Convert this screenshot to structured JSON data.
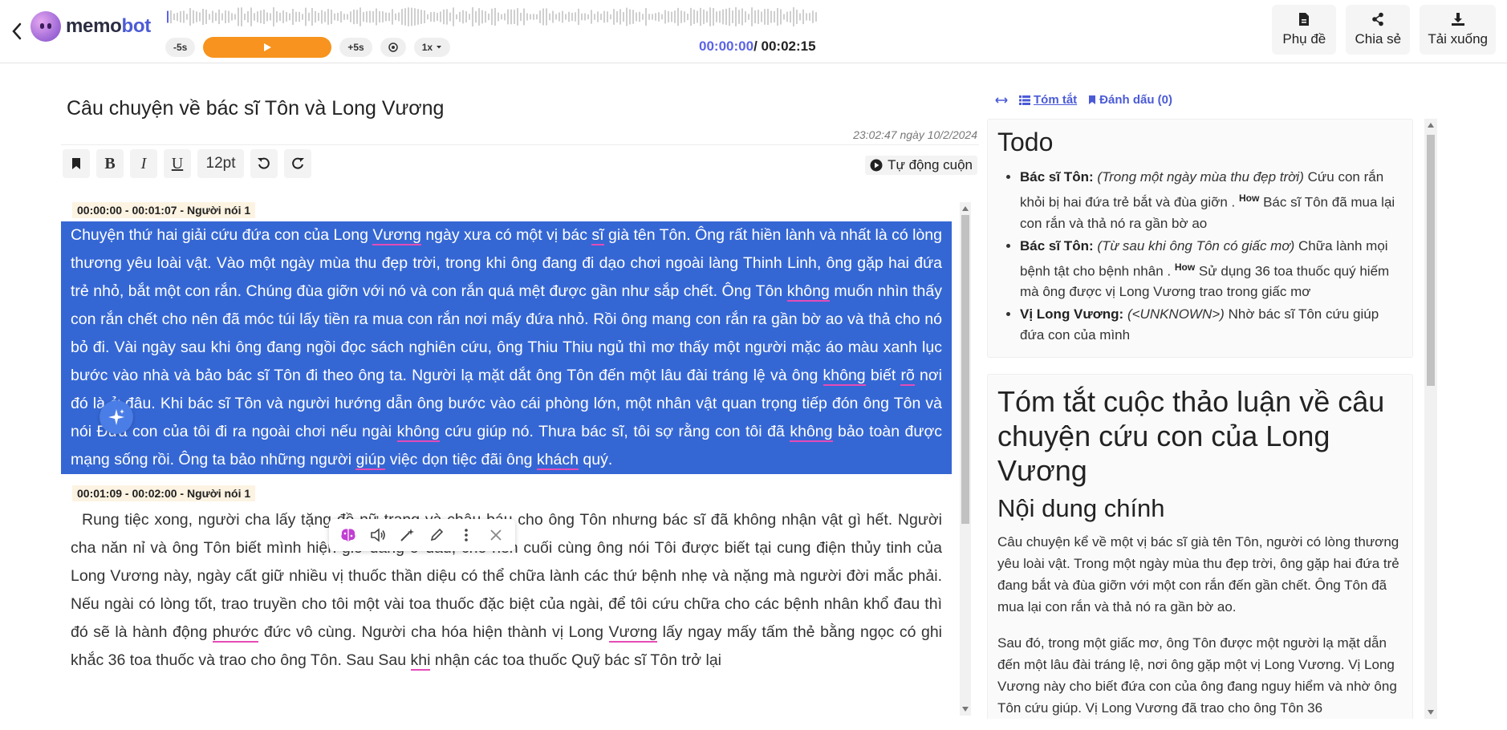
{
  "app": {
    "logo_prefix": "memo",
    "logo_suffix": "bot"
  },
  "player": {
    "skip_back": "-5s",
    "skip_forward": "+5s",
    "speed": "1x",
    "current_time": "00:00:00",
    "total_time": "/ 00:02:15"
  },
  "top_actions": [
    {
      "label": "Phụ đề",
      "icon": "file-icon"
    },
    {
      "label": "Chia sẻ",
      "icon": "share-icon"
    },
    {
      "label": "Tải xuống",
      "icon": "download-icon"
    }
  ],
  "document": {
    "title": "Câu chuyện về bác sĩ Tôn và Long Vương",
    "date": "23:02:47 ngày 10/2/2024"
  },
  "toolbar": {
    "bold": "B",
    "italic": "I",
    "underline": "U",
    "font_size": "12pt",
    "autoscroll": "Tự động cuộn"
  },
  "segments": [
    {
      "header": "00:00:00 - 00:01:07 - Người nói 1",
      "parts": [
        " Chuyện thứ hai giải cứu đứa con của Long ",
        {
          "u": "Vương"
        },
        " ngày xưa có một vị bác ",
        {
          "u": "sĩ"
        },
        " già tên Tôn. Ông rất hiền lành và nhất là có lòng thương yêu loài vật. Vào một ngày mùa thu đẹp trời, trong khi ông đang đi dạo chơi ngoài làng Thinh Linh, ông gặp hai đứa trẻ nhỏ, bắt một con rắn. Chúng đùa giỡn với nó và con rắn quá mệt được gần như sắp chết. Ông Tôn ",
        {
          "u": "không"
        },
        " muốn nhìn thấy con rắn chết cho nên đã móc túi lấy tiền ra mua con rắn nơi mấy đứa nhỏ. Rồi ông mang con rắn ra gần bờ ao và thả cho nó bỏ đi. Vài ngày sau khi ông đang ngồi đọc sách nghiên cứu, ông Thiu Thiu ngủ thì mơ thấy một người mặc áo màu xanh lục bước vào nhà và bảo bác sĩ Tôn đi theo ông ta. Người lạ mặt dắt ông Tôn đến một lâu đài tráng lệ và ông ",
        {
          "u": "không"
        },
        " biết ",
        {
          "u": "rõ"
        },
        " nơi đó là ở đâu. Khi bác sĩ Tôn và người hướng dẫn ông bước vào cái phòng lớn, một nhân vật quan trọng tiếp đón ông Tôn và nói Đứa con của tôi đi ra ngoài chơi nếu ngài ",
        {
          "u": "không"
        },
        " cứu giúp nó. Thưa bác sĩ, tôi sợ rằng con tôi đã ",
        {
          "u": "không"
        },
        " bảo toàn được mạng sống rồi. Ông ta bảo những người ",
        {
          "u": "giúp"
        },
        " việc dọn tiệc đãi ông ",
        {
          "u": "khách"
        },
        " quý."
      ]
    },
    {
      "header": "00:01:09 - 00:02:00 - Người nói 1",
      "parts": [
        "Rung tiệc xong, người cha lấy tặng đồ nữ trang và châu báu cho ông Tôn nhưng bác sĩ đã không nhận vật gì hết. Người cha năn nỉ và ông Tôn biết mình hiện giờ đang ở đâu, cho nên cuối cùng ông nói Tôi được biết tại cung điện thủy tinh của Long Vương này, ngày cất giữ nhiều vị thuốc thần diệu có thể chữa lành các thứ bệnh nhẹ và nặng mà người đời mắc phải. Nếu ngài có lòng tốt, trao truyền cho tôi một vài toa thuốc đặc biệt của ngài, để tôi cứu chữa cho các bệnh nhân khổ đau thì đó sẽ là hành động ",
        {
          "u": "phước"
        },
        " đức vô cùng. Người cha hóa hiện thành vị Long ",
        {
          "u": "Vương"
        },
        " lấy ngay mấy tấm thẻ bằng ngọc có ghi khắc 36 toa thuốc và trao cho ông Tôn. Sau Sau ",
        {
          "u": "khi"
        },
        " nhận các toa thuốc Quỹ bác sĩ Tôn trở lại"
      ]
    }
  ],
  "right_panel": {
    "tabs": [
      {
        "label": "Tóm tắt",
        "icon": "list-icon",
        "active": true
      },
      {
        "label": "Đánh dấu (0)",
        "icon": "bookmark-icon",
        "active": false
      }
    ],
    "todo": {
      "title": "Todo",
      "items": [
        {
          "who": "Bác sĩ Tôn:",
          "when": "(Trong một ngày mùa thu đẹp trời)",
          "what": "Cứu con rắn khỏi bị hai đứa trẻ bắt và đùa giỡn .",
          "how_label": "How",
          "how": "Bác sĩ Tôn đã mua lại con rắn và thả nó ra gần bờ ao"
        },
        {
          "who": "Bác sĩ Tôn:",
          "when": "(Từ sau khi ông Tôn có giấc mơ)",
          "what": "Chữa lành mọi bệnh tật cho bệnh nhân .",
          "how_label": "How",
          "how": "Sử dụng 36 toa thuốc quý hiếm mà ông được vị Long Vương trao trong giấc mơ"
        },
        {
          "who": "Vị Long Vương:",
          "when": "(<UNKNOWN>)",
          "what": "Nhờ bác sĩ Tôn cứu giúp đứa con của mình",
          "how_label": "",
          "how": ""
        }
      ]
    },
    "summary": {
      "title": "Tóm tắt cuộc thảo luận về câu chuyện cứu con của Long Vương",
      "subtitle": "Nội dung chính",
      "paragraphs": [
        "Câu chuyện kể về một vị bác sĩ già tên Tôn, người có lòng thương yêu loài vật. Trong một ngày mùa thu đẹp trời, ông gặp hai đứa trẻ đang bắt và đùa giỡn với một con rắn đến gần chết. Ông Tôn đã mua lại con rắn và thả nó ra gần bờ ao.",
        "Sau đó, trong một giấc mơ, ông Tôn được một người lạ mặt dẫn đến một lâu đài tráng lệ, nơi ông gặp một vị Long Vương. Vị Long Vương này cho biết đứa con của ông đang nguy hiểm và nhờ ông Tôn cứu giúp. Vị Long Vương đã trao cho ông Tôn 36"
      ]
    }
  },
  "colors": {
    "accent": "#4b5bd6",
    "play": "#f7931e",
    "selection": "#3567d4",
    "underline": "#e54bb7"
  }
}
